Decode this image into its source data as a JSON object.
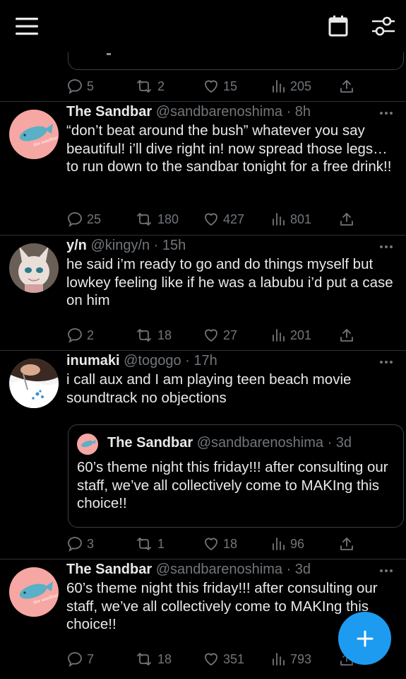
{
  "colors": {
    "background": "#000000",
    "accent": "#1d9bf0",
    "muted": "#71767b",
    "text": "#e7e9ea"
  },
  "topbar": {
    "menu_icon": "hamburger-menu-icon",
    "calendar_icon": "calendar-icon",
    "filter_icon": "sliders-filter-icon"
  },
  "partial_tweet": {
    "actions": {
      "replies": "5",
      "retweets": "2",
      "likes": "15",
      "views": "205"
    }
  },
  "tweets": [
    {
      "name": "The Sandbar",
      "handle": "@sandbarenoshima",
      "time": "· 8h",
      "text": "“don’t beat around the bush” whatever you say beautiful! i’ll dive right in! now spread those legs… to run down to the sandbar tonight for a free drink!!",
      "actions": {
        "replies": "25",
        "retweets": "180",
        "likes": "427",
        "views": "801"
      }
    },
    {
      "name": "y/n",
      "handle": "@kingy/n",
      "time": "· 15h",
      "text": "he said i’m ready to go and do things myself but lowkey feeling like if he was a labubu i’d put a case on him",
      "actions": {
        "replies": "2",
        "retweets": "18",
        "likes": "27",
        "views": "201"
      }
    },
    {
      "name": "inumaki",
      "handle": "@togogo",
      "time": "· 17h",
      "text": "i call aux and I am playing teen beach movie soundtrack no objections",
      "quote": {
        "name": "The Sandbar",
        "handle": "@sandbarenoshima",
        "time": "· 3d",
        "text": "60’s theme night this friday!!! after consulting our staff, we’ve all collectively come to MAKIng this choice!!"
      },
      "actions": {
        "replies": "3",
        "retweets": "1",
        "likes": "18",
        "views": "96"
      }
    },
    {
      "name": "The Sandbar",
      "handle": "@sandbarenoshima",
      "time": "· 3d",
      "text": "60’s theme night this friday!!! after consulting our staff, we’ve all collectively come to MAKIng this choice!!",
      "actions": {
        "replies": "7",
        "retweets": "18",
        "likes": "351",
        "views": "793"
      }
    }
  ],
  "fab": {
    "icon": "plus-icon"
  }
}
